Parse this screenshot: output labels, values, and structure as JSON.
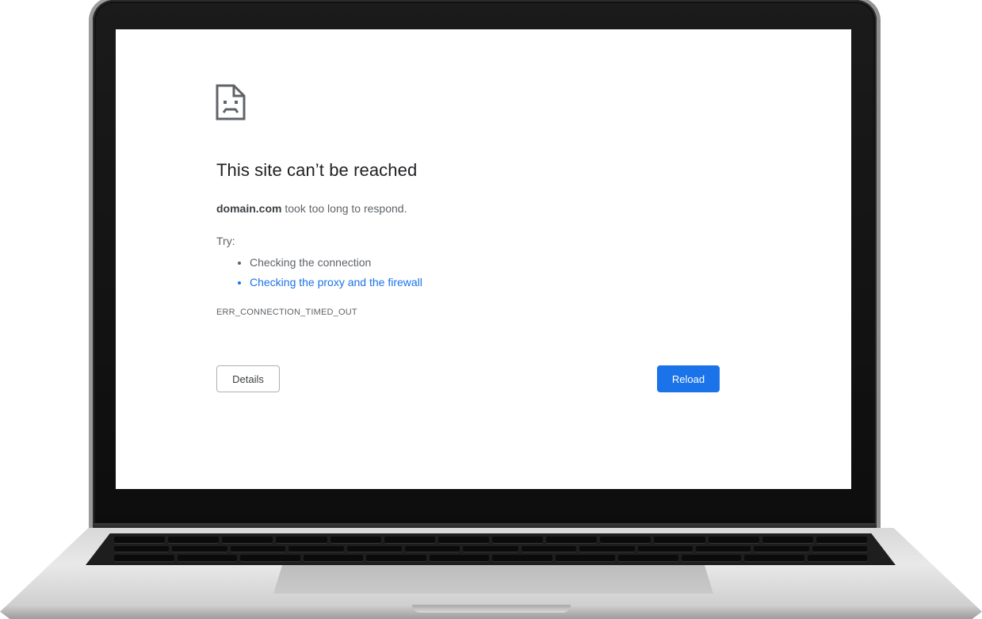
{
  "error_page": {
    "icon": "sad-document-icon",
    "title": "This site can’t be reached",
    "message": {
      "domain": "domain.com",
      "text": " took too long to respond."
    },
    "try_label": "Try:",
    "suggestions": [
      {
        "label": "Checking the connection",
        "is_link": false
      },
      {
        "label": "Checking the proxy and the firewall",
        "is_link": true
      }
    ],
    "error_code": "ERR_CONNECTION_TIMED_OUT",
    "buttons": {
      "details_label": "Details",
      "reload_label": "Reload"
    }
  },
  "colors": {
    "accent": "#1a73e8",
    "title_text": "#202124",
    "body_text": "#5f6368"
  }
}
